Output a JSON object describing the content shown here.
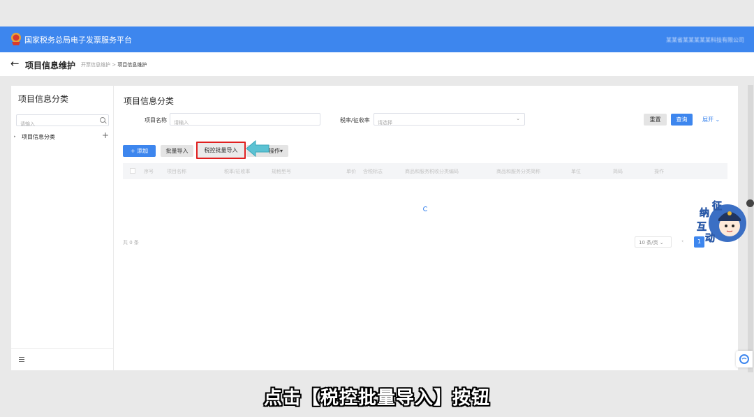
{
  "header": {
    "app_title": "国家税务总局电子发票服务平台",
    "user_info": "某某省某某某某某科技有限公司"
  },
  "subheader": {
    "page_title": "项目信息维护",
    "breadcrumb_parent": "开票信息维护",
    "breadcrumb_sep": ">",
    "breadcrumb_current": "项目信息维护"
  },
  "sidebar": {
    "title": "项目信息分类",
    "search_placeholder": "请输入",
    "tree_caret": "▸",
    "tree_root": "项目信息分类",
    "add_symbol": "+"
  },
  "main": {
    "title": "项目信息分类",
    "filters": {
      "item_name_label": "项目名称",
      "item_name_placeholder": "请输入",
      "tax_rate_label": "税率/征收率",
      "tax_rate_placeholder": "请选择",
      "select_arrow": "⌄"
    },
    "search_buttons": {
      "reset": "重置",
      "query": "查询",
      "expand": "展开 ⌄"
    },
    "toolbar": {
      "add": "+ 添加",
      "batch_import": "批量导入",
      "tax_batch_import": "税控批量导入",
      "more": "操作▾"
    },
    "table": {
      "columns": [
        "序号",
        "项目名称",
        "税率/征收率",
        "规格型号",
        "单价",
        "含税标志",
        "商品和服务税收分类编码",
        "商品和服务分类简称",
        "单位",
        "简码",
        "操作"
      ]
    },
    "pagination": {
      "total": "共 0 条",
      "page_size": "10 条/页 ⌄",
      "prev": "‹",
      "current_page": "1"
    }
  },
  "mascot": {
    "line1": "征",
    "line2": "纳",
    "line3": "互",
    "line4": "动"
  },
  "caption": "点击【税控批量导入】按钮",
  "colors": {
    "primary": "#3d86ee",
    "highlight_border": "#e02020",
    "arrow": "#5bc2d3"
  }
}
